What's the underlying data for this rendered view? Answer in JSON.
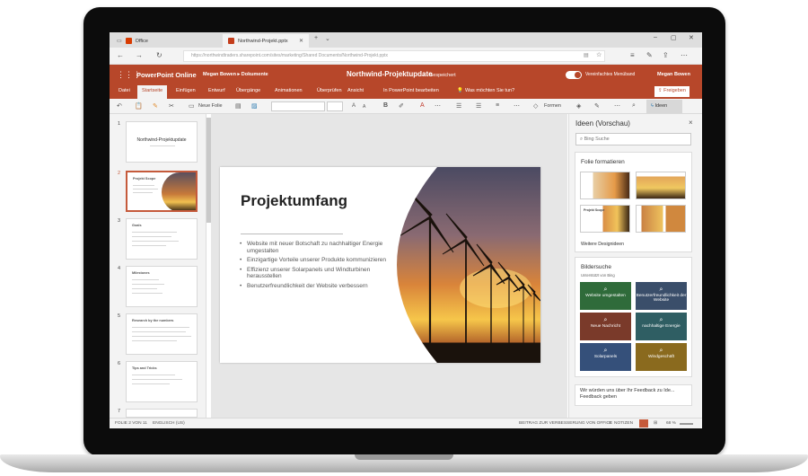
{
  "browser": {
    "tabs": [
      {
        "label": "Office",
        "close": "✕"
      },
      {
        "label": "Northwind-Projekt.pptx",
        "close": "✕"
      }
    ],
    "new_tab": "+",
    "tab_menu": "⌄",
    "url": "https://northwindtraders.sharepoint.com/sites/marketing/Shared Documents/Northwind-Projekt.pptx"
  },
  "app": {
    "name": "PowerPoint Online",
    "breadcrumb": "Megan Bowen ▸ Dokumente",
    "doc_title": "Northwind-Projektupdate",
    "separator": "–",
    "save_status": "Gespeichert",
    "simplified_ribbon": "Vereinfachtes Menüband",
    "user": "Megan Bowen"
  },
  "menu": {
    "tabs": [
      "Datei",
      "Startseite",
      "Einfügen",
      "Entwurf",
      "Übergänge",
      "Animationen",
      "Überprüfen",
      "Ansicht"
    ],
    "selected": "Startseite",
    "open_in_desktop": "In PowerPoint bearbeiten",
    "tell_me": "Was möchten Sie tun?",
    "share": "Freigeben"
  },
  "ribbon": {
    "new_slide": "Neue Folie",
    "shapes": "Formen",
    "ideas": "Ideen"
  },
  "thumbnails": {
    "numbers": [
      "1",
      "2",
      "3",
      "4",
      "5",
      "6",
      "7"
    ],
    "slide1_title": "Northwind-Projektupdate",
    "slide2_title": "Projekt Scope",
    "slide3_title": "Goals",
    "slide4_title": "Milestones",
    "slide5_title": "Research by the numbers",
    "slide6_title": "Tips and Tricks"
  },
  "slide": {
    "title": "Projektumfang",
    "bullets": [
      "Website mit neuer Botschaft zu nachhaltiger Energie umgestalten",
      "Einzigartige Vorteile unserer Produkte kommunizieren",
      "Effizienz unserer Solarpanels und Windturbinen herausstellen",
      "Benutzerfreundlichkeit der Website verbessern"
    ]
  },
  "ideas_pane": {
    "title": "Ideen (Vorschau)",
    "close": "×",
    "search_placeholder": "Bing Suche",
    "format_title": "Folie formatieren",
    "design_thumb_title": "Projekt Scope",
    "more_designs": "Weitere Designideen",
    "image_search_title": "Bildersuche",
    "powered_by": "Unterstützt von Bing",
    "image_tiles": [
      {
        "label": "Website umgestalten",
        "color": "#2f6b3a"
      },
      {
        "label": "Benutzerfreundlichkeit der Website",
        "color": "#3a4e6a"
      },
      {
        "label": "Neue Nachricht",
        "color": "#7a3a2a"
      },
      {
        "label": "nachhaltige Energie",
        "color": "#2f5e63"
      },
      {
        "label": "Solarpanels",
        "color": "#35507a"
      },
      {
        "label": "Windgeschäft",
        "color": "#8a6a1e"
      }
    ],
    "feedback": "Wir würden uns über Ihr Feedback zu Ide... Feedback geben"
  },
  "statusbar": {
    "slide_of": "FOLIE 2 VON 11",
    "language": "ENGLISCH (US)",
    "improve": "BEITRAG ZUR VERBESSERUNG VON OFFICE",
    "notes": "NOTIZEN",
    "zoom": "68 %"
  },
  "colors": {
    "accent": "#b7472a",
    "selection": "#c55a3b"
  }
}
